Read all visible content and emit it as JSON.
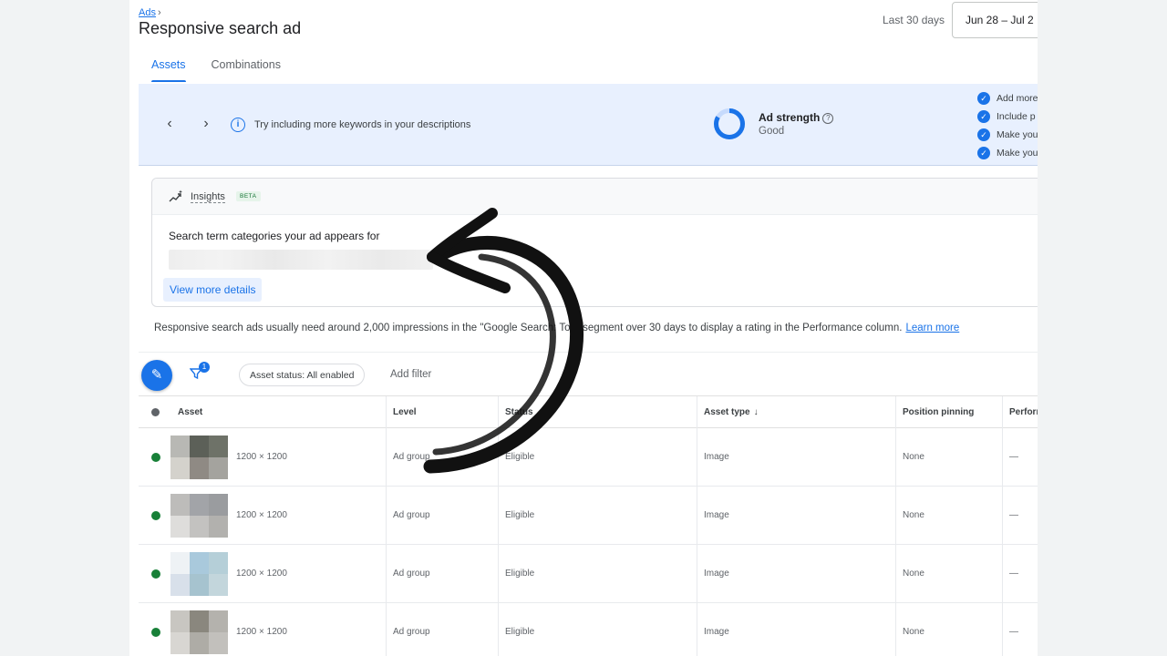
{
  "header": {
    "breadcrumb": "Ads",
    "title": "Responsive search ad",
    "date_range_label": "Last 30 days",
    "date_range_value": "Jun 28 – Jul 2"
  },
  "tabs": [
    {
      "label": "Assets",
      "active": true
    },
    {
      "label": "Combinations",
      "active": false
    }
  ],
  "banner": {
    "tip": "Try including more keywords in your descriptions",
    "strength_label": "Ad strength",
    "strength_value": "Good",
    "checklist": [
      "Add more",
      "Include p",
      "Make you",
      "Make you"
    ]
  },
  "insights": {
    "title": "Insights",
    "badge": "BETA",
    "subtitle": "Search term categories your ad appears for",
    "details_button": "View more details"
  },
  "info": {
    "text": "Responsive search ads usually need around 2,000 impressions in the \"Google Search: Top\" segment over 30 days to display a rating in the Performance column.",
    "learn_more": "Learn more"
  },
  "toolbar": {
    "filter_count": "1",
    "status_chip": "Asset status: All enabled",
    "add_filter": "Add filter"
  },
  "table": {
    "columns": [
      "Asset",
      "Level",
      "Status",
      "Asset type",
      "Position pinning",
      "Performance"
    ],
    "rows": [
      {
        "dims": "1200 × 1200",
        "level": "Ad group",
        "status": "Eligible",
        "type": "Image",
        "pinning": "None",
        "performance": "—"
      },
      {
        "dims": "1200 × 1200",
        "level": "Ad group",
        "status": "Eligible",
        "type": "Image",
        "pinning": "None",
        "performance": "—"
      },
      {
        "dims": "1200 × 1200",
        "level": "Ad group",
        "status": "Eligible",
        "type": "Image",
        "pinning": "None",
        "performance": "—"
      },
      {
        "dims": "1200 × 1200",
        "level": "Ad group",
        "status": "Eligible",
        "type": "Image",
        "pinning": "None",
        "performance": "—"
      }
    ]
  },
  "icons": {
    "prev": "chevron-left-icon",
    "next": "chevron-right-icon",
    "tip": "info-icon",
    "insights": "trending-sparkle-icon",
    "edit": "pencil-icon",
    "filter": "filter-icon",
    "check": "check-circle-icon",
    "help": "help-icon",
    "sort": "arrow-down-icon"
  },
  "colors": {
    "accent": "#1a73e8",
    "banner_bg": "#e8f0fe",
    "enabled_dot": "#188038",
    "annotation_arrow": "#111111"
  }
}
